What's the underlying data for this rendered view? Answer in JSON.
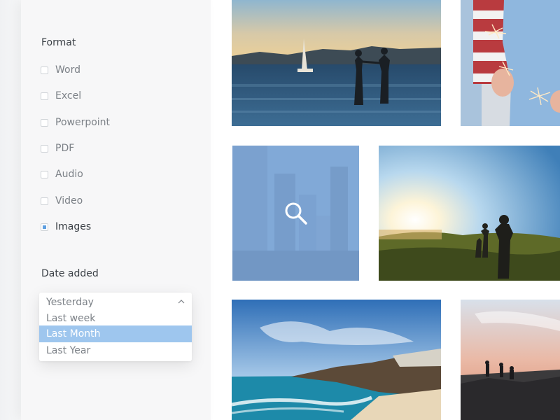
{
  "filters": {
    "format": {
      "title": "Format",
      "items": [
        {
          "label": "Word",
          "checked": false
        },
        {
          "label": "Excel",
          "checked": false
        },
        {
          "label": "Powerpoint",
          "checked": false
        },
        {
          "label": "PDF",
          "checked": false
        },
        {
          "label": "Audio",
          "checked": false
        },
        {
          "label": "Video",
          "checked": false
        },
        {
          "label": "Images",
          "checked": true
        }
      ]
    },
    "date_added": {
      "title": "Date added",
      "selected": "Yesterday",
      "options": [
        "Last week",
        "Last Month",
        "Last Year"
      ],
      "highlighted": "Last Month",
      "expanded": true
    }
  },
  "gallery": {
    "photos": [
      {
        "subject": "couple-at-sea"
      },
      {
        "subject": "sparklers"
      },
      {
        "subject": "city-skyline",
        "hovered": true
      },
      {
        "subject": "sunset-hikers"
      },
      {
        "subject": "beach-coast"
      },
      {
        "subject": "cliff-sunset"
      }
    ]
  },
  "colors": {
    "accent": "#5e9fe0",
    "dropdown_highlight": "#9ec6ee",
    "overlay": "#89b4e8"
  },
  "icons": {
    "zoom": "search-icon",
    "dropdown": "chevron-up-icon"
  }
}
